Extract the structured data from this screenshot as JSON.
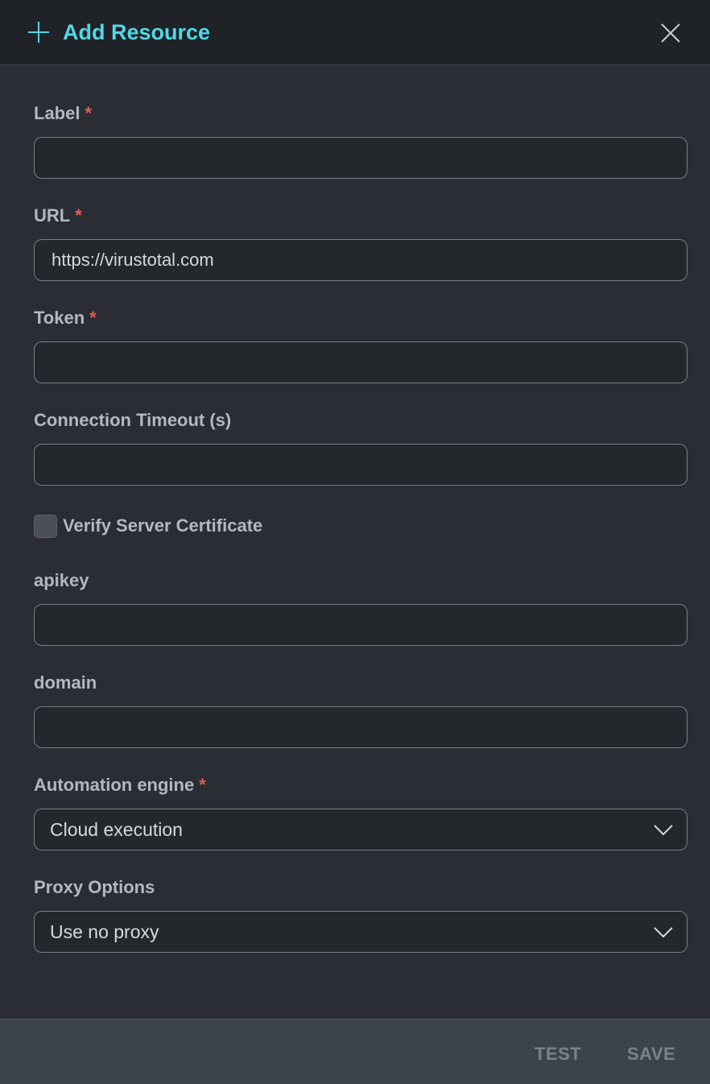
{
  "header": {
    "title": "Add Resource",
    "accent_color": "#4fd8e6"
  },
  "fields": {
    "label": {
      "label": "Label",
      "required_mark": "*",
      "value": ""
    },
    "url": {
      "label": "URL",
      "required_mark": "*",
      "value": "https://virustotal.com"
    },
    "token": {
      "label": "Token",
      "required_mark": "*",
      "value": ""
    },
    "timeout": {
      "label": "Connection Timeout (s)",
      "value": ""
    },
    "verify": {
      "label": "Verify Server Certificate",
      "checked": false
    },
    "apikey": {
      "label": "apikey",
      "value": ""
    },
    "domain": {
      "label": "domain",
      "value": ""
    },
    "engine": {
      "label": "Automation engine",
      "required_mark": "*",
      "selected": "Cloud execution"
    },
    "proxy": {
      "label": "Proxy Options",
      "selected": "Use no proxy"
    }
  },
  "footer": {
    "test_label": "TEST",
    "save_label": "SAVE"
  },
  "colors": {
    "required": "#e85a5a",
    "background": "#2a2d33",
    "header_bg": "#1f2227",
    "footer_bg": "#3d434b"
  }
}
